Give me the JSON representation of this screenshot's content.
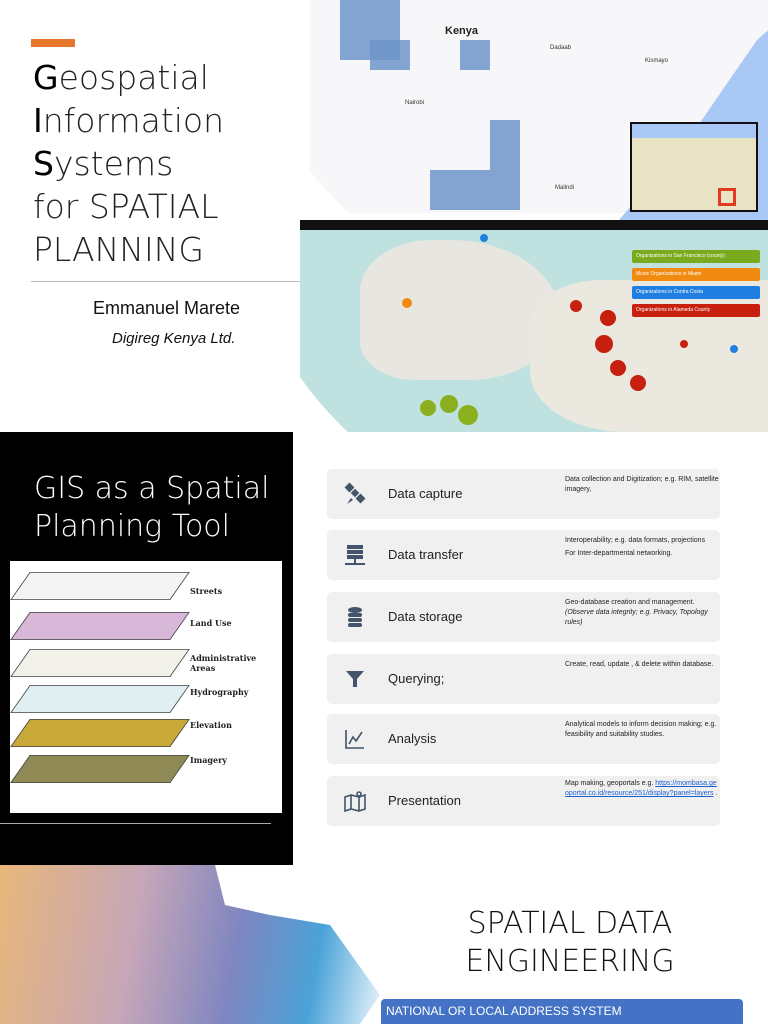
{
  "slide1": {
    "title_lines": [
      {
        "initial": "G",
        "rest": "eospatial"
      },
      {
        "initial": "I",
        "rest": "nformation"
      },
      {
        "initial": "S",
        "rest": "ystems"
      },
      {
        "initial": "",
        "rest": "for SPATIAL"
      },
      {
        "initial": "",
        "rest": "PLANNING"
      }
    ],
    "author": "Emmanuel Marete",
    "organization": "Digireg Kenya Ltd.",
    "map_label": "Kenya",
    "map_places": [
      "Nairobi",
      "Malindi",
      "Dadaab",
      "Kismayo"
    ],
    "cluster_legend": [
      "Organizations in San Francisco (county)",
      "Music Organizations in Miami",
      "Organizations in Contra Costa",
      "Organizations in Alameda County"
    ],
    "legend_colors": [
      "#7aab1e",
      "#f08a10",
      "#1f7fe0",
      "#c8200e"
    ]
  },
  "slide2": {
    "title": "GIS as a Spatial Planning Tool",
    "layers": [
      "Streets",
      "Land Use",
      "Administrative Areas",
      "Hydrography",
      "Elevation",
      "Imagery"
    ],
    "cards": [
      {
        "label": "Data capture",
        "icon": "satellite-icon",
        "desc": [
          "Data collection and Digitization; e.g. RIM, satellite imagery,"
        ]
      },
      {
        "label": "Data transfer",
        "icon": "server-network-icon",
        "desc": [
          "Interoperability; e.g. data formats, projections",
          "For Inter-departmental networking."
        ]
      },
      {
        "label": "Data storage",
        "icon": "database-icon",
        "desc": [
          "Geo-database creation and management.",
          "(Observe data integrity; e.g. Privacy, Topology rules)"
        ]
      },
      {
        "label": "Querying;",
        "icon": "filter-icon",
        "desc": [
          "Create, read, update , & delete within database."
        ]
      },
      {
        "label": "Analysis",
        "icon": "line-chart-icon",
        "desc": [
          "Analytical models to inform decision making; e.g. feasibility and suitability studies."
        ]
      },
      {
        "label": "Presentation",
        "icon": "map-pin-icon",
        "desc": [
          "Map making,  geoportals e.g. "
        ],
        "link": "https://mombasa.geoportal.co.id/resource/251/display?panel=layers",
        "link_suffix": " ."
      }
    ]
  },
  "slide3": {
    "title": "SPATIAL DATA ENGINEERING",
    "bar_label": "NATIONAL OR LOCAL ADDRESS SYSTEM"
  }
}
